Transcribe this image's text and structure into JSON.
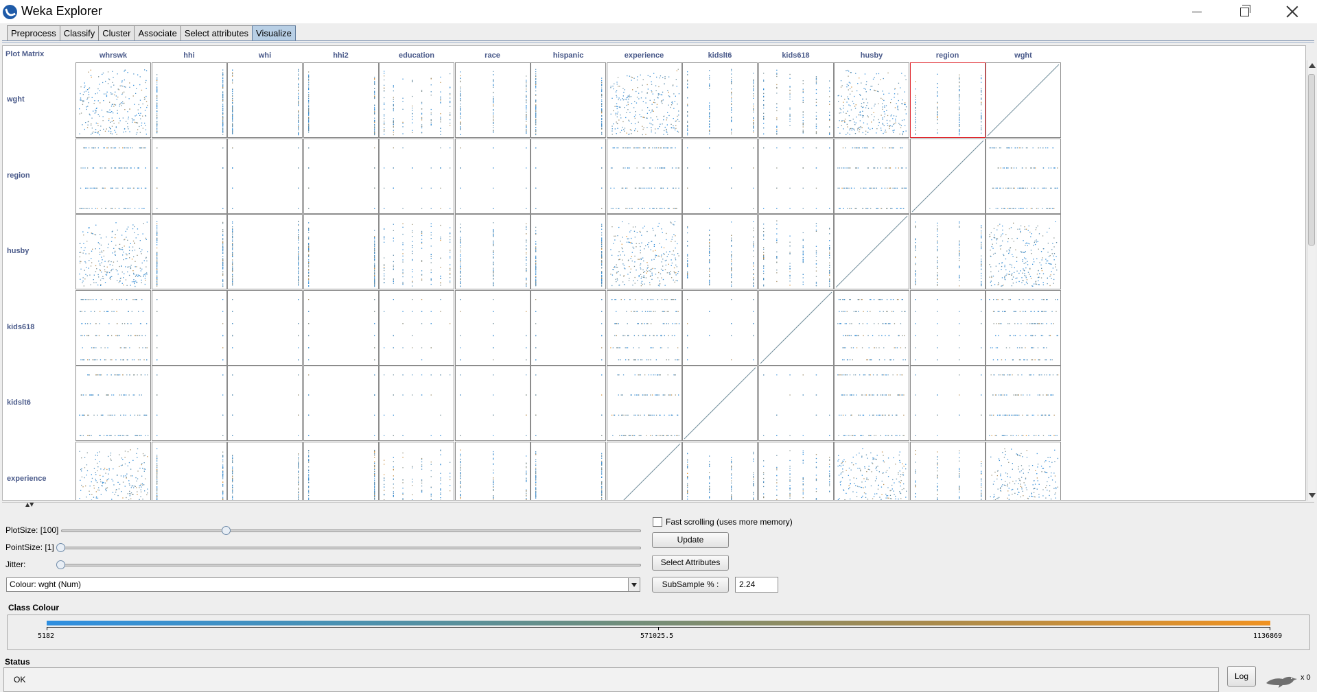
{
  "window": {
    "title": "Weka Explorer"
  },
  "tabs": [
    "Preprocess",
    "Classify",
    "Cluster",
    "Associate",
    "Select attributes",
    "Visualize"
  ],
  "active_tab": "Visualize",
  "plot_matrix": {
    "label": "Plot Matrix",
    "columns": [
      "whrswk",
      "hhi",
      "whi",
      "hhi2",
      "education",
      "race",
      "hispanic",
      "experience",
      "kidslt6",
      "kids618",
      "husby",
      "region",
      "wght"
    ],
    "rows": [
      "wght",
      "region",
      "husby",
      "kids618",
      "kidslt6",
      "experience"
    ],
    "selected_cell": {
      "row": "wght",
      "column": "region"
    }
  },
  "controls": {
    "plot_size_label": "PlotSize: [100]",
    "plot_size_value": 100,
    "point_size_label": "PointSize: [1]",
    "point_size_value": 1,
    "jitter_label": "Jitter:",
    "jitter_value": 0,
    "colour_select": "Colour: wght  (Num)",
    "fast_scrolling_label": "Fast scrolling (uses more memory)",
    "fast_scrolling_checked": false,
    "update_button": "Update",
    "select_attributes_button": "Select Attributes",
    "subsample_button": "SubSample % :",
    "subsample_value": "2.24"
  },
  "class_colour": {
    "label": "Class Colour",
    "min": "5182",
    "mid": "571025.5",
    "max": "1136869",
    "gradient_start": "#2f8fe0",
    "gradient_end": "#f09221"
  },
  "status": {
    "label": "Status",
    "text": "OK",
    "log_button": "Log",
    "task_count": "x 0"
  }
}
